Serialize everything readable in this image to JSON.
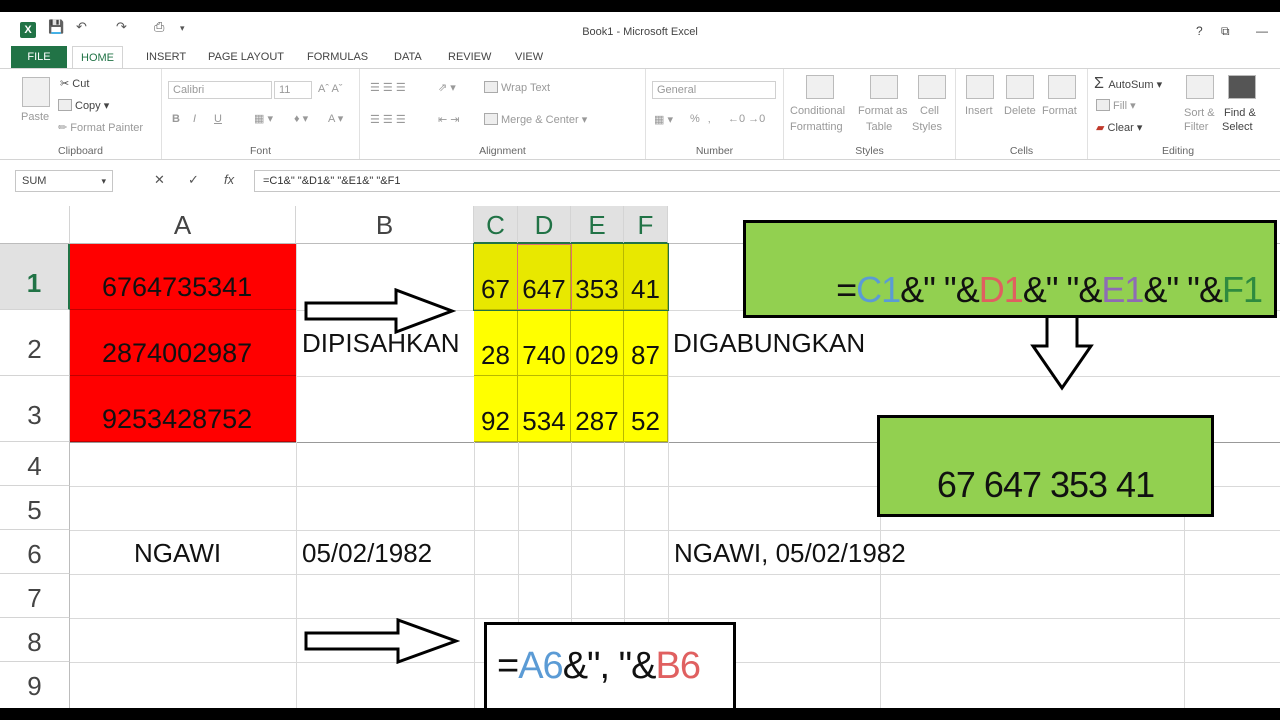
{
  "window": {
    "title": "Book1 - Microsoft Excel",
    "help": "?",
    "ribbon_toggle": "⧉",
    "minimize": "—"
  },
  "tabs": [
    "FILE",
    "HOME",
    "INSERT",
    "PAGE LAYOUT",
    "FORMULAS",
    "DATA",
    "REVIEW",
    "VIEW"
  ],
  "ribbon": {
    "clipboard": {
      "label": "Clipboard",
      "paste": "Paste",
      "cut": "Cut",
      "copy": "Copy",
      "format_painter": "Format Painter"
    },
    "font": {
      "label": "Font",
      "name": "Calibri",
      "size": "11",
      "bold": "B",
      "italic": "I",
      "underline": "U"
    },
    "alignment": {
      "label": "Alignment",
      "wrap": "Wrap Text",
      "merge": "Merge & Center"
    },
    "number": {
      "label": "Number",
      "format": "General",
      "percent": "%"
    },
    "styles": {
      "label": "Styles",
      "conditional": "Conditional",
      "formatting": "Formatting",
      "format_as": "Format as",
      "table": "Table",
      "cell": "Cell",
      "styles": "Styles"
    },
    "cells": {
      "label": "Cells",
      "insert": "Insert",
      "delete": "Delete",
      "format": "Format"
    },
    "editing": {
      "label": "Editing",
      "autosum": "AutoSum",
      "fill": "Fill",
      "clear": "Clear",
      "sort": "Sort &",
      "filter": "Filter",
      "find": "Find &",
      "select": "Select"
    }
  },
  "formula_bar": {
    "name_box": "SUM",
    "cancel": "✕",
    "enter": "✓",
    "fx": "fx",
    "formula": "=C1&\" \"&D1&\" \"&E1&\" \"&F1"
  },
  "columns": [
    "A",
    "B",
    "C",
    "D",
    "E",
    "F"
  ],
  "rows": [
    "1",
    "2",
    "3",
    "4",
    "5",
    "6",
    "7",
    "8",
    "9"
  ],
  "cells": {
    "A1": "6764735341",
    "A2": "2874002987",
    "A3": "9253428752",
    "B2": "DIPISAHKAN",
    "C1": "67",
    "D1": "647",
    "E1": "353",
    "F1": "41",
    "C2": "28",
    "D2": "740",
    "E2": "029",
    "F2": "87",
    "C3": "92",
    "D3": "534",
    "E3": "287",
    "F3": "52",
    "G2": "DIGABUNGKAN",
    "A6": "NGAWI",
    "B6": "05/02/1982",
    "G6": "NGAWI, 05/02/1982"
  },
  "annotations": {
    "formula1": {
      "eq": "=",
      "c1": "C1",
      "s1": "&\" \"&",
      "d1": "D1",
      "s2": "&\" \"&",
      "e1": "E1",
      "s3": "&\" \"&",
      "f1": "F1"
    },
    "result1": "67 647 353 41",
    "formula2": {
      "eq": "=",
      "a6": "A6",
      "mid": "&\", \"&",
      "b6": "B6"
    }
  },
  "colors": {
    "excel_green": "#217346",
    "red_fill": "#ff0000",
    "yellow_fill": "#ffff00",
    "callout_green": "#92d050"
  }
}
